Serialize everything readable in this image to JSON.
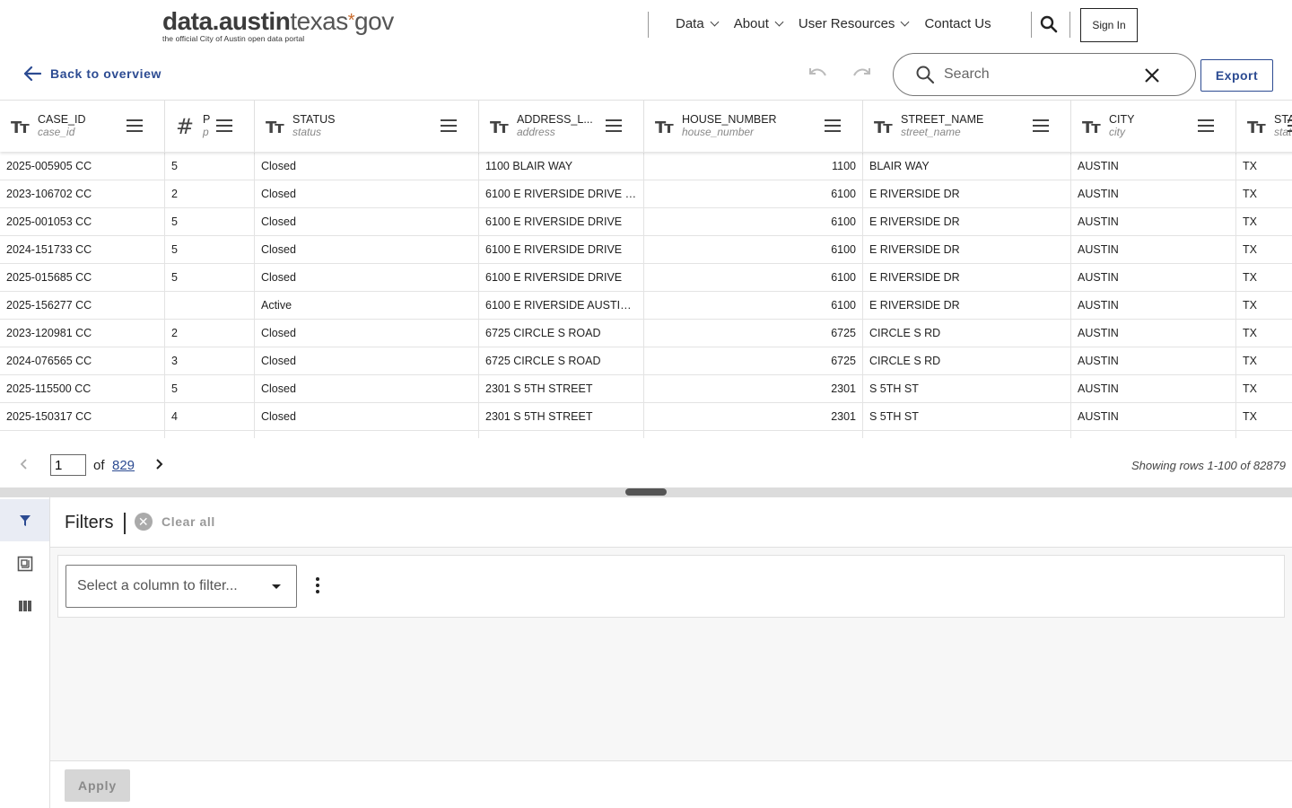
{
  "header": {
    "logo_main_dark": "data.austin",
    "logo_main_light": "texas",
    "logo_star": "*",
    "logo_main_end": "gov",
    "logo_tagline": "the official City of Austin open data portal",
    "nav": [
      {
        "label": "Data"
      },
      {
        "label": "About"
      },
      {
        "label": "User Resources"
      },
      {
        "label": "Contact Us"
      }
    ],
    "signin_label": "Sign In"
  },
  "toolbar": {
    "back_label": "Back to overview",
    "search_placeholder": "Search",
    "export_label": "Export"
  },
  "grid": {
    "columns": [
      {
        "type": "text",
        "name": "CASE_ID",
        "field": "case_id"
      },
      {
        "type": "number",
        "name": "P",
        "field": "p"
      },
      {
        "type": "text",
        "name": "STATUS",
        "field": "status"
      },
      {
        "type": "text",
        "name": "ADDRESS_L...",
        "field": "address"
      },
      {
        "type": "text",
        "name": "HOUSE_NUMBER",
        "field": "house_number"
      },
      {
        "type": "text",
        "name": "STREET_NAME",
        "field": "street_name"
      },
      {
        "type": "text",
        "name": "CITY",
        "field": "city"
      },
      {
        "type": "text",
        "name": "STA",
        "field": "stat"
      }
    ],
    "rows": [
      [
        "2025-005905 CC",
        "5",
        "Closed",
        "1100 BLAIR WAY",
        "1100",
        "BLAIR WAY",
        "AUSTIN",
        "TX"
      ],
      [
        "2023-106702 CC",
        "2",
        "Closed",
        "6100 E RIVERSIDE DRIVE U…",
        "6100",
        "E RIVERSIDE DR",
        "AUSTIN",
        "TX"
      ],
      [
        "2025-001053 CC",
        "5",
        "Closed",
        "6100 E RIVERSIDE DRIVE",
        "6100",
        "E RIVERSIDE DR",
        "AUSTIN",
        "TX"
      ],
      [
        "2024-151733 CC",
        "5",
        "Closed",
        "6100 E RIVERSIDE DRIVE",
        "6100",
        "E RIVERSIDE DR",
        "AUSTIN",
        "TX"
      ],
      [
        "2025-015685 CC",
        "5",
        "Closed",
        "6100 E RIVERSIDE DRIVE",
        "6100",
        "E RIVERSIDE DR",
        "AUSTIN",
        "TX"
      ],
      [
        "2025-156277 CC",
        "",
        "Active",
        "6100 E RIVERSIDE AUSTIN …",
        "6100",
        "E RIVERSIDE DR",
        "AUSTIN",
        "TX"
      ],
      [
        "2023-120981 CC",
        "2",
        "Closed",
        "6725 CIRCLE S ROAD",
        "6725",
        "CIRCLE S RD",
        "AUSTIN",
        "TX"
      ],
      [
        "2024-076565 CC",
        "3",
        "Closed",
        "6725 CIRCLE S ROAD",
        "6725",
        "CIRCLE S RD",
        "AUSTIN",
        "TX"
      ],
      [
        "2025-115500 CC",
        "5",
        "Closed",
        "2301 S 5TH STREET",
        "2301",
        "S 5TH ST",
        "AUSTIN",
        "TX"
      ],
      [
        "2025-150317 CC",
        "4",
        "Closed",
        "2301 S 5TH STREET",
        "2301",
        "S 5TH ST",
        "AUSTIN",
        "TX"
      ],
      [
        "",
        "",
        "",
        "",
        "",
        "",
        "",
        ""
      ]
    ]
  },
  "pager": {
    "current_page": "1",
    "of_label": "of",
    "total_pages": "829",
    "showing": "Showing rows 1-100 of 82879"
  },
  "filters": {
    "title": "Filters",
    "clear_all": "Clear all",
    "select_placeholder": "Select a column to filter...",
    "apply_label": "Apply"
  },
  "colors": {
    "accent": "#2c4b92",
    "logo_star": "#c96a2b"
  }
}
